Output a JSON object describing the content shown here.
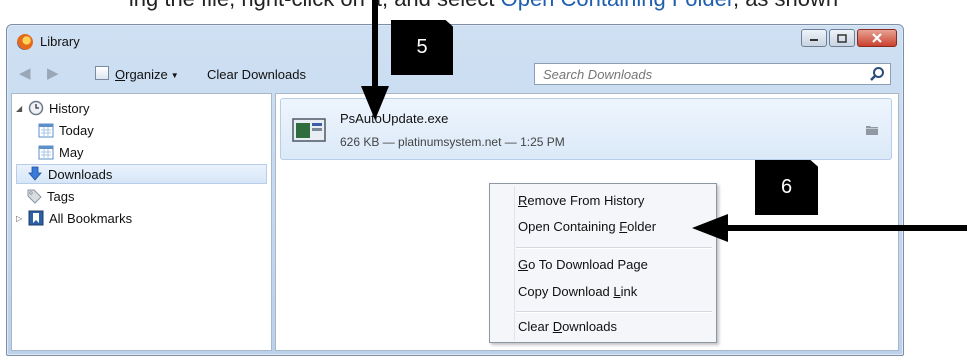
{
  "caption": {
    "prefix": "ing the file, right-click on it, and select ",
    "highlight": "Open Containing Folder",
    "suffix": ", as shown"
  },
  "window": {
    "title": "Library",
    "buttons": [
      "minimize",
      "maximize",
      "close"
    ]
  },
  "toolbar": {
    "organize_prefix": "",
    "organize_underlined": "O",
    "organize_rest": "rganize",
    "clear_label": "Clear Downloads",
    "search_placeholder": "Search Downloads"
  },
  "sidebar": {
    "items": [
      {
        "label": "History",
        "icon": "clock-icon"
      },
      {
        "label": "Today",
        "icon": "calendar-icon"
      },
      {
        "label": "May",
        "icon": "calendar-icon"
      },
      {
        "label": "Downloads",
        "icon": "download-arrow-icon",
        "selected": true
      },
      {
        "label": "Tags",
        "icon": "tag-icon"
      },
      {
        "label": "All Bookmarks",
        "icon": "bookmarks-icon"
      }
    ]
  },
  "download": {
    "filename": "PsAutoUpdate.exe",
    "meta": "626 KB — platinumsystem.net — 1:25 PM"
  },
  "context_menu": {
    "items": [
      {
        "before": "",
        "u": "R",
        "after": "emove From History"
      },
      {
        "before": "Open Containing ",
        "u": "F",
        "after": "older"
      },
      {
        "before": "",
        "u": "G",
        "after": "o To Download Page"
      },
      {
        "before": "Copy Download ",
        "u": "L",
        "after": "ink"
      },
      {
        "before": "Clear ",
        "u": "D",
        "after": "ownloads"
      }
    ]
  },
  "callouts": {
    "step5": "5",
    "step6": "6"
  },
  "colors": {
    "highlight": "#1f5fb0",
    "selection": "#d6e6f8",
    "close_button": "#c9422f"
  }
}
